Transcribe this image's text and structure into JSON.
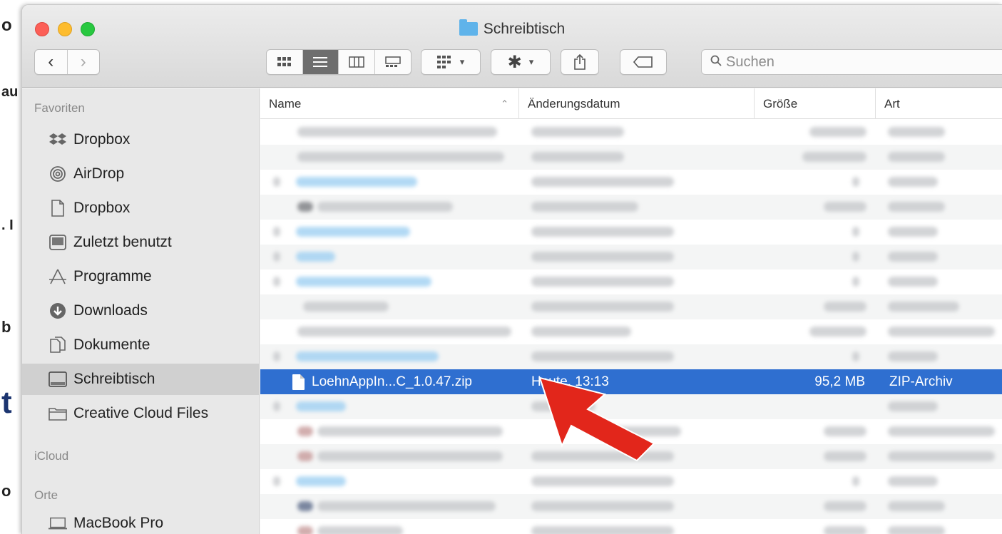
{
  "window": {
    "title": "Schreibtisch",
    "nav": {
      "back": "‹",
      "forward": "›"
    },
    "search_placeholder": "Suchen"
  },
  "sidebar": {
    "favorites_heading": "Favoriten",
    "items": [
      {
        "label": "Dropbox",
        "icon": "dropbox-icon"
      },
      {
        "label": "AirDrop",
        "icon": "airdrop-icon"
      },
      {
        "label": "Dropbox",
        "icon": "document-icon"
      },
      {
        "label": "Zuletzt benutzt",
        "icon": "recents-icon"
      },
      {
        "label": "Programme",
        "icon": "applications-icon"
      },
      {
        "label": "Downloads",
        "icon": "downloads-icon"
      },
      {
        "label": "Dokumente",
        "icon": "documents-icon"
      },
      {
        "label": "Schreibtisch",
        "icon": "desktop-icon"
      },
      {
        "label": "Creative Cloud Files",
        "icon": "folder-icon"
      }
    ],
    "icloud_heading": "iCloud",
    "locations_heading": "Orte",
    "locations": [
      {
        "label": "MacBook Pro",
        "icon": "laptop-icon"
      }
    ]
  },
  "columns": {
    "name": "Name",
    "date": "Änderungsdatum",
    "size": "Größe",
    "kind": "Art"
  },
  "selected_file": {
    "name": "LoehnAppIn...C_1.0.47.zip",
    "date": "Heute, 13:13",
    "size": "95,2 MB",
    "kind": "ZIP-Archiv"
  },
  "background_fragments": [
    "o",
    "au",
    ". I",
    "b",
    "t",
    "o"
  ],
  "colors": {
    "selection": "#2f6fd0",
    "arrow": "#e2261b",
    "sidebar": "#e8e8e8"
  }
}
